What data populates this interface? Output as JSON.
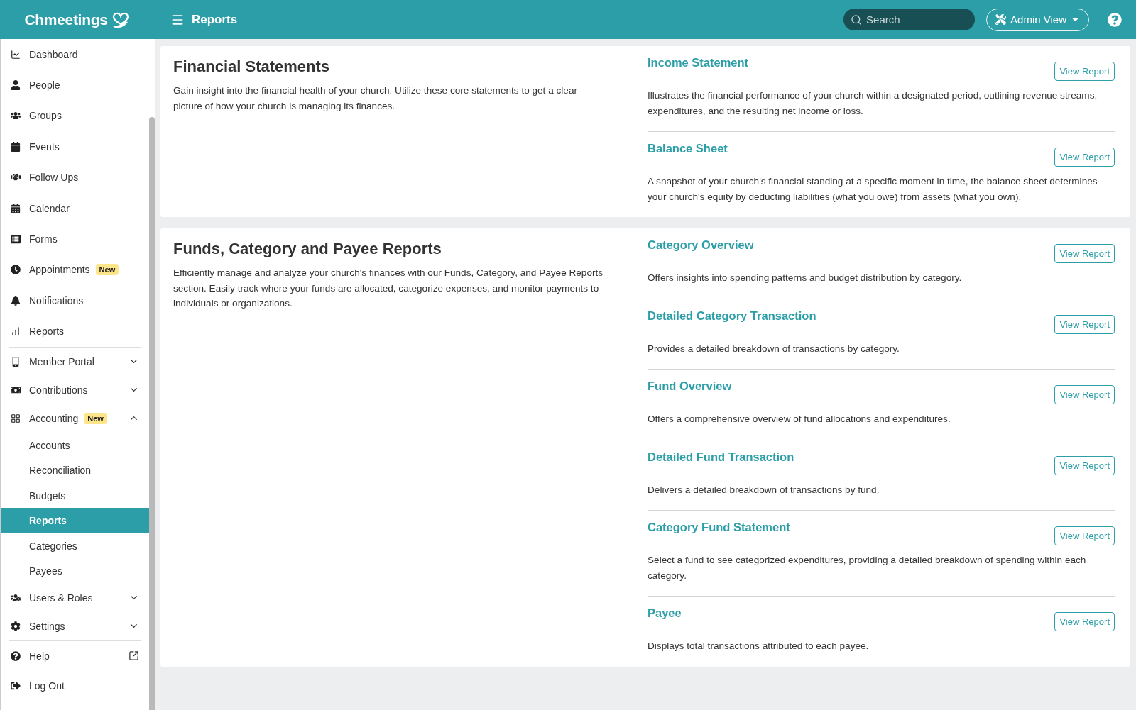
{
  "topbar": {
    "logo": "Chmeetings",
    "page_title": "Reports",
    "search": {
      "placeholder": "Search"
    },
    "view_button": "Admin View"
  },
  "sidebar": {
    "sections": [
      {
        "items": [
          {
            "label": "Dashboard",
            "selected": false
          },
          {
            "label": "People",
            "selected": false
          },
          {
            "label": "Groups",
            "selected": false
          },
          {
            "label": "Events",
            "selected": false
          },
          {
            "label": "Follow Ups",
            "selected": false
          },
          {
            "label": "Calendar",
            "selected": false
          },
          {
            "label": "Forms",
            "selected": false
          },
          {
            "label": "Appointments",
            "badge": "New",
            "selected": false
          },
          {
            "label": "Notifications",
            "selected": false
          },
          {
            "label": "Reports",
            "selected": false
          }
        ]
      },
      {
        "items": [
          {
            "label": "Member Portal",
            "expanded": false,
            "selected": false
          },
          {
            "label": "Contributions",
            "expanded": false,
            "selected": false
          },
          {
            "label": "Accounting",
            "badge": "New",
            "expanded": true,
            "selected": false,
            "children": [
              {
                "label": "Accounts",
                "selected": false
              },
              {
                "label": "Reconciliation",
                "selected": false
              },
              {
                "label": "Budgets",
                "selected": false
              },
              {
                "label": "Reports",
                "selected": true
              },
              {
                "label": "Categories",
                "selected": false
              },
              {
                "label": "Payees",
                "selected": false
              }
            ]
          },
          {
            "label": "Users & Roles",
            "expanded": false,
            "selected": false
          },
          {
            "label": "Settings",
            "expanded": false,
            "selected": false
          }
        ]
      },
      {
        "items": [
          {
            "label": "Help",
            "external": true,
            "selected": false
          },
          {
            "label": "Log Out",
            "selected": false
          }
        ]
      }
    ]
  },
  "cards": [
    {
      "title": "Financial Statements",
      "description": "Gain insight into the financial health of your church. Utilize these core statements to get a clear picture of how your church is managing its finances.",
      "reports": [
        {
          "title": "Income Statement",
          "description": "Illustrates the financial performance of your church within a designated period, outlining revenue streams, expenditures, and the resulting net income or loss.",
          "button": "View Report"
        },
        {
          "title": "Balance Sheet",
          "description": "A snapshot of your church's financial standing at a specific moment in time, the balance sheet determines your church's equity by deducting liabilities (what you owe) from assets (what you own).",
          "button": "View Report"
        }
      ]
    },
    {
      "title": "Funds, Category and Payee Reports",
      "description": "Efficiently manage and analyze your church's finances with our Funds, Category, and Payee Reports section. Easily track where your funds are allocated, categorize expenses, and monitor payments to individuals or organizations.",
      "reports": [
        {
          "title": "Category Overview",
          "description": "Offers insights into spending patterns and budget distribution by category.",
          "button": "View Report"
        },
        {
          "title": "Detailed Category Transaction",
          "description": "Provides a detailed breakdown of transactions by category.",
          "button": "View Report"
        },
        {
          "title": "Fund Overview",
          "description": "Offers a comprehensive overview of fund allocations and expenditures.",
          "button": "View Report"
        },
        {
          "title": "Detailed Fund Transaction",
          "description": "Delivers a detailed breakdown of transactions by fund.",
          "button": "View Report"
        },
        {
          "title": "Category Fund Statement",
          "description": "Select a fund to see categorized expenditures, providing a detailed breakdown of spending within each category.",
          "button": "View Report"
        },
        {
          "title": "Payee",
          "description": "Displays total transactions attributed to each payee.",
          "button": "View Report"
        }
      ]
    }
  ]
}
